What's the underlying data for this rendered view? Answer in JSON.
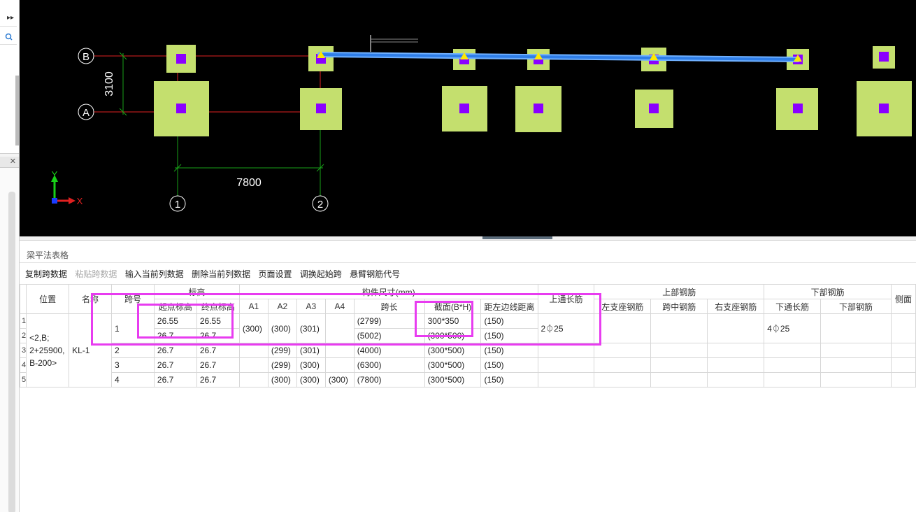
{
  "canvas": {
    "axis_rows": [
      "B",
      "A"
    ],
    "axis_cols": [
      "1",
      "2"
    ],
    "dim_vertical": "3100",
    "dim_horizontal": "7800",
    "coord_y": "Y",
    "coord_x": "X"
  },
  "panel": {
    "title": "梁平法表格",
    "toolbar": [
      "复制跨数据",
      "粘贴跨数据",
      "输入当前列数据",
      "删除当前列数据",
      "页面设置",
      "调换起始跨",
      "悬臂钢筋代号"
    ]
  },
  "table": {
    "h_position": "位置",
    "h_name": "名称",
    "h_span_no": "跨号",
    "h_elevation": "标高",
    "h_start_elev": "起点标高",
    "h_end_elev": "终点标高",
    "h_dims": "构件尺寸(mm)",
    "h_a1": "A1",
    "h_a2": "A2",
    "h_a3": "A3",
    "h_a4": "A4",
    "h_span_len": "跨长",
    "h_section": "截面(B*H)",
    "h_offset": "距左边线距离",
    "h_top_through": "上通长筋",
    "h_top_rebar": "上部钢筋",
    "h_left_seat": "左支座钢筋",
    "h_mid_span": "跨中钢筋",
    "h_right_seat": "右支座钢筋",
    "h_bottom_rebar": "下部钢筋",
    "h_bottom_through": "下通长筋",
    "h_bottom_rebar2": "下部钢筋",
    "h_side": "侧面",
    "position_value": "<2,B;\n2+25900,\nB-200>",
    "name_value": "KL-1",
    "row_numbers": [
      "1",
      "2",
      "3",
      "4",
      "5"
    ],
    "rows": [
      {
        "span": "1",
        "start": "26.55",
        "end": "26.55",
        "a1": "(300)",
        "a2": "(300)",
        "a3": "(301)",
        "a4": "",
        "len": "(2799)",
        "section": "300*350",
        "offset": "(150)",
        "top_through": "2⏀25",
        "bottom_through": "4⏀25"
      },
      {
        "span": "",
        "start": "26.7",
        "end": "26.7",
        "a1": "",
        "a2": "",
        "a3": "",
        "a4": "",
        "len": "(5002)",
        "section": "(300*500)",
        "offset": "(150)",
        "top_through": "",
        "bottom_through": ""
      },
      {
        "span": "2",
        "start": "26.7",
        "end": "26.7",
        "a1": "",
        "a2": "(299)",
        "a3": "(301)",
        "a4": "",
        "len": "(4000)",
        "section": "(300*500)",
        "offset": "(150)",
        "top_through": "",
        "bottom_through": ""
      },
      {
        "span": "3",
        "start": "26.7",
        "end": "26.7",
        "a1": "",
        "a2": "(299)",
        "a3": "(300)",
        "a4": "",
        "len": "(6300)",
        "section": "(300*500)",
        "offset": "(150)",
        "top_through": "",
        "bottom_through": ""
      },
      {
        "span": "4",
        "start": "26.7",
        "end": "26.7",
        "a1": "",
        "a2": "(300)",
        "a3": "(300)",
        "a4": "(300)",
        "len": "(7800)",
        "section": "(300*500)",
        "offset": "(150)",
        "top_through": "",
        "bottom_through": ""
      }
    ]
  },
  "colors": {
    "column": "#c4df6e",
    "column_core": "#8a00ff",
    "axis_line": "#e02020",
    "dim_line": "#18a018",
    "beam": "#2f7ee8",
    "highlight": "#e83cf0"
  }
}
